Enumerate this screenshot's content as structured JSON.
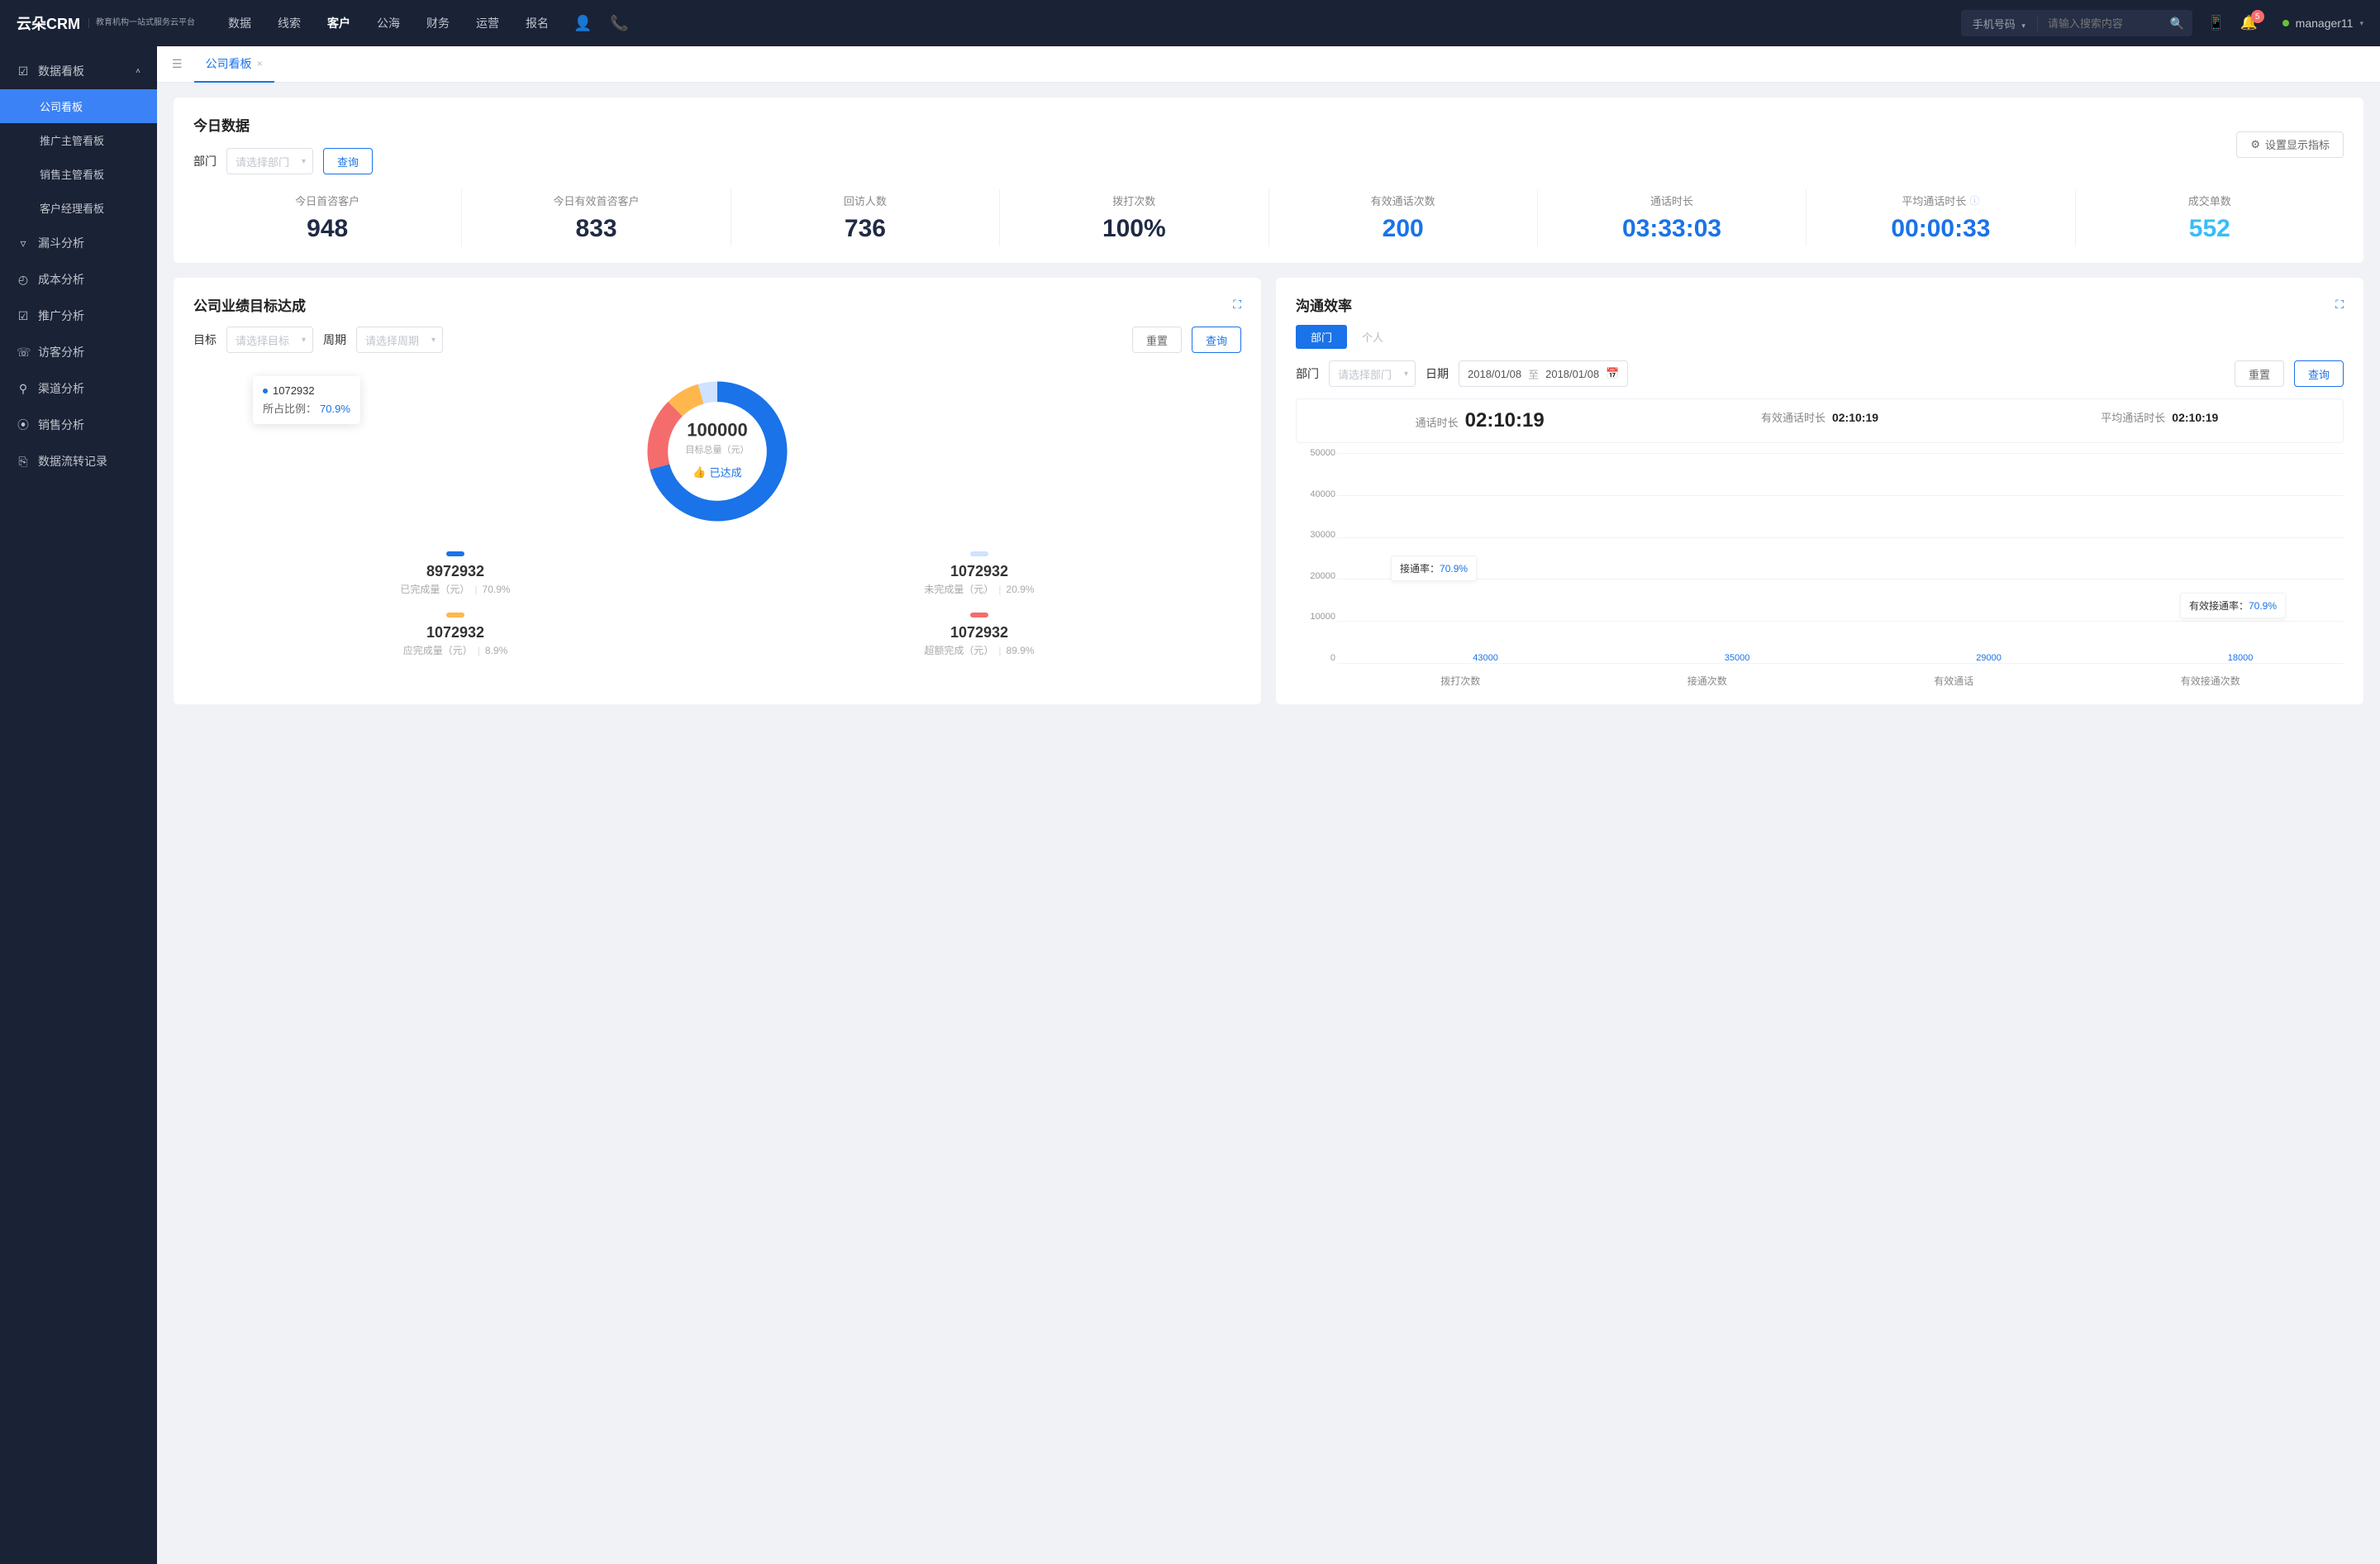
{
  "header": {
    "logo": "云朵CRM",
    "logo_sub": "教育机构一站式服务云平台",
    "nav": [
      "数据",
      "线索",
      "客户",
      "公海",
      "财务",
      "运营",
      "报名"
    ],
    "nav_active": 2,
    "search_category": "手机号码",
    "search_placeholder": "请输入搜索内容",
    "notif_count": "5",
    "username": "manager11"
  },
  "sidebar": {
    "group": "数据看板",
    "subs": [
      "公司看板",
      "推广主管看板",
      "销售主管看板",
      "客户经理看板"
    ],
    "items": [
      "漏斗分析",
      "成本分析",
      "推广分析",
      "访客分析",
      "渠道分析",
      "销售分析",
      "数据流转记录"
    ],
    "icons": [
      "▿",
      "◴",
      "☑",
      "☏",
      "⚲",
      "⦿",
      "⎘"
    ]
  },
  "tabs": {
    "active": "公司看板"
  },
  "today": {
    "title": "今日数据",
    "filter_label": "部门",
    "filter_placeholder": "请选择部门",
    "query": "查询",
    "settings_btn": "设置显示指标",
    "stats": [
      {
        "label": "今日首咨客户",
        "value": "948",
        "cls": "dark"
      },
      {
        "label": "今日有效首咨客户",
        "value": "833",
        "cls": "dark"
      },
      {
        "label": "回访人数",
        "value": "736",
        "cls": "dark"
      },
      {
        "label": "拨打次数",
        "value": "100%",
        "cls": "dark"
      },
      {
        "label": "有效通话次数",
        "value": "200",
        "cls": "blue"
      },
      {
        "label": "通话时长",
        "value": "03:33:03",
        "cls": "blue"
      },
      {
        "label": "平均通话时长",
        "value": "00:00:33",
        "cls": "blue",
        "info": true
      },
      {
        "label": "成交单数",
        "value": "552",
        "cls": "teal"
      }
    ]
  },
  "goal_card": {
    "title": "公司业绩目标达成",
    "label_target": "目标",
    "ph_target": "请选择目标",
    "label_cycle": "周期",
    "ph_cycle": "请选择周期",
    "reset": "重置",
    "query": "查询",
    "center_value": "100000",
    "center_sub": "目标总量（元）",
    "achieved": "已达成",
    "tooltip_value": "1072932",
    "tooltip_label": "所占比例：",
    "tooltip_pct": "70.9%",
    "legend": [
      {
        "color": "#1a73e8",
        "value": "8972932",
        "text": "已完成量（元）",
        "pct": "70.9%"
      },
      {
        "color": "#cfe2ff",
        "value": "1072932",
        "text": "未完成量（元）",
        "pct": "20.9%"
      },
      {
        "color": "#ffb74d",
        "value": "1072932",
        "text": "应完成量（元）",
        "pct": "8.9%"
      },
      {
        "color": "#f56c6c",
        "value": "1072932",
        "text": "超额完成（元）",
        "pct": "89.9%"
      }
    ]
  },
  "comm_card": {
    "title": "沟通效率",
    "tab_dept": "部门",
    "tab_personal": "个人",
    "filter_label": "部门",
    "filter_ph": "请选择部门",
    "date_label": "日期",
    "date_from": "2018/01/08",
    "date_to_sep": "至",
    "date_to": "2018/01/08",
    "reset": "重置",
    "query": "查询",
    "time_stats": [
      {
        "label": "通话时长",
        "value": "02:10:19",
        "big": true
      },
      {
        "label": "有效通话时长",
        "value": "02:10:19"
      },
      {
        "label": "平均通话时长",
        "value": "02:10:19"
      }
    ],
    "annot1_label": "接通率：",
    "annot1_pct": "70.9%",
    "annot2_label": "有效接通率：",
    "annot2_pct": "70.9%"
  },
  "chart_data": {
    "donut": {
      "type": "pie",
      "title": "公司业绩目标达成",
      "series": [
        {
          "name": "已完成量（元）",
          "value": 8972932,
          "pct": 70.9,
          "color": "#1a73e8"
        },
        {
          "name": "未完成量（元）",
          "value": 1072932,
          "pct": 20.9,
          "color": "#cfe2ff"
        },
        {
          "name": "应完成量（元）",
          "value": 1072932,
          "pct": 8.9,
          "color": "#ffb74d"
        },
        {
          "name": "超额完成（元）",
          "value": 1072932,
          "pct": 89.9,
          "color": "#f56c6c"
        }
      ],
      "total_target": 100000
    },
    "bars": {
      "type": "bar",
      "ylim": [
        0,
        50000
      ],
      "yticks": [
        0,
        10000,
        20000,
        30000,
        40000,
        50000
      ],
      "categories": [
        "拨打次数",
        "接通次数",
        "有效通话",
        "有效接通次数"
      ],
      "values": [
        43000,
        35000,
        29000,
        18000
      ],
      "annotations": [
        {
          "between": [
            0,
            1
          ],
          "label": "接通率：",
          "pct": "70.9%"
        },
        {
          "between": [
            2,
            3
          ],
          "label": "有效接通率：",
          "pct": "70.9%"
        }
      ]
    }
  }
}
